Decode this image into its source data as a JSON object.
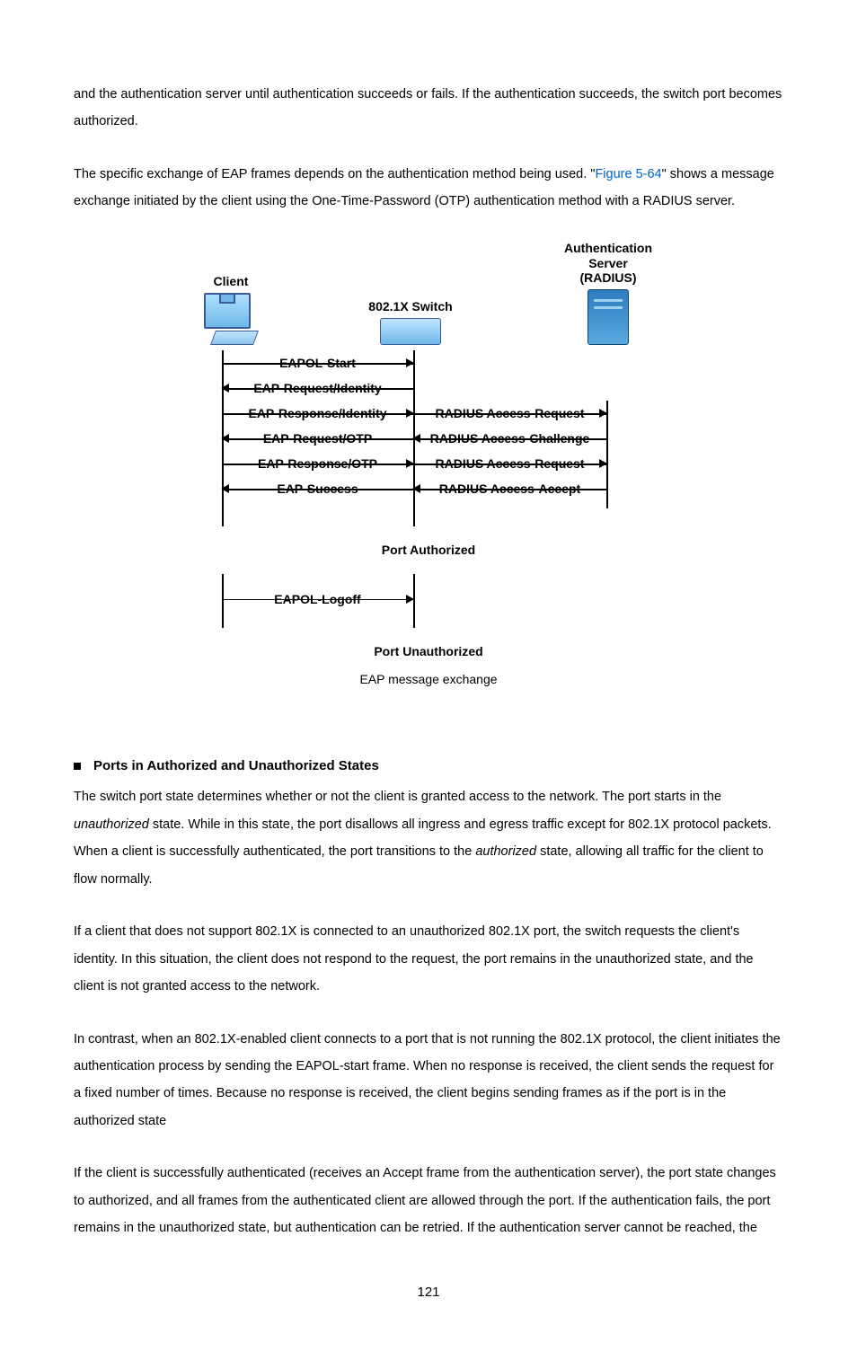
{
  "para1": "and the authentication server until authentication succeeds or fails. If the authentication succeeds, the switch port becomes authorized.",
  "para2a": "The specific exchange of EAP frames depends on the authentication method being used. \"",
  "figref": "Figure 5-64",
  "para2b": "\" shows a message exchange initiated by the client using the One-Time-Password (OTP) authentication method with a RADIUS server.",
  "diagram": {
    "client": "Client",
    "switch": "802.1X Switch",
    "server_l1": "Authentication",
    "server_l2": "Server",
    "server_l3": "(RADIUS)",
    "m1": "EAPOL-Start",
    "m2": "EAP-Request/Identity",
    "m3": "EAP-Response/Identity",
    "m4": "EAP-Request/OTP",
    "m5": "EAP-Response/OTP",
    "m6": "EAP-Success",
    "r1": "RADIUS Access-Request",
    "r2": "RADIUS Access-Challenge",
    "r3": "RADIUS Access-Request",
    "r4": "RADIUS Access-Accept",
    "state1": "Port Authorized",
    "m7": "EAPOL-Logoff",
    "state2": "Port Unauthorized"
  },
  "caption": "EAP message exchange",
  "section": "Ports in Authorized and Unauthorized States",
  "p3a": "The switch port state determines whether or not the client is granted access to the network. The port starts in the ",
  "p3_em1": "unauthorized",
  "p3b": " state. While in this state, the port disallows all ingress and egress traffic except for 802.1X protocol packets. When a client is successfully authenticated, the port transitions to the ",
  "p3_em2": "authorized",
  "p3c": " state, allowing all traffic for the client to flow normally.",
  "p4": "If a client that does not support 802.1X is connected to an unauthorized 802.1X port, the switch requests the client's identity. In this situation, the client does not respond to the request, the port remains in the unauthorized state, and the client is not granted access to the network.",
  "p5": "In contrast, when an 802.1X-enabled client connects to a port that is not running the 802.1X protocol, the client initiates the authentication process by sending the EAPOL-start frame. When no response is received, the client sends the request for a fixed number of times. Because no response is received, the client begins sending frames as if the port is in the authorized state",
  "p6": "If the client is successfully authenticated (receives an Accept frame from the authentication server), the port state changes to authorized, and all frames from the authenticated client are allowed through the port. If the authentication fails, the port remains in the unauthorized state, but authentication can be retried. If the authentication server cannot be reached, the",
  "pagenum": "121"
}
